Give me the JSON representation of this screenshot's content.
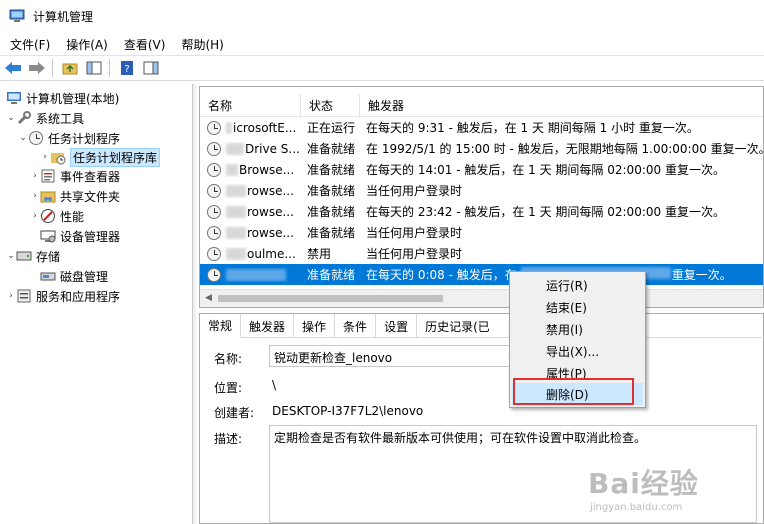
{
  "window": {
    "title": "计算机管理"
  },
  "menu": [
    "文件(F)",
    "操作(A)",
    "查看(V)",
    "帮助(H)"
  ],
  "toolbar": {
    "icons": [
      "back-icon",
      "forward-icon",
      "up-folder-icon",
      "show-tree-icon",
      "help-icon",
      "action-pane-icon"
    ]
  },
  "tree": {
    "root": "计算机管理(本地)",
    "system_tools": "系统工具",
    "task_scheduler": "任务计划程序",
    "task_library": "任务计划程序库",
    "event_viewer": "事件查看器",
    "shared_folders": "共享文件夹",
    "performance": "性能",
    "device_manager": "设备管理器",
    "storage": "存储",
    "disk_management": "磁盘管理",
    "services": "服务和应用程序"
  },
  "tasklist": {
    "headers": {
      "name": "名称",
      "status": "状态",
      "trigger": "触发器"
    },
    "rows": [
      {
        "name": "icrosoftE...",
        "status": "正在运行",
        "trigger": "在每天的 9:31 - 触发后，在 1 天 期间每隔 1 小时 重复一次。"
      },
      {
        "name": "Drive S...",
        "status": "准备就绪",
        "trigger": "在 1992/5/1 的 15:00 时 - 触发后，无限期地每隔 1.00:00:00 重复一次。"
      },
      {
        "name": "Browse...",
        "status": "准备就绪",
        "trigger": "在每天的 14:01 - 触发后，在 1 天 期间每隔 02:00:00 重复一次。"
      },
      {
        "name": "rowse...",
        "status": "准备就绪",
        "trigger": "当任何用户登录时"
      },
      {
        "name": "rowse...",
        "status": "准备就绪",
        "trigger": "在每天的 23:42 - 触发后，在 1 天 期间每隔 02:00:00 重复一次。"
      },
      {
        "name": "rowse...",
        "status": "准备就绪",
        "trigger": "当任何用户登录时"
      },
      {
        "name": "oulme...",
        "status": "禁用",
        "trigger": "当任何用户登录时"
      },
      {
        "name": "",
        "status": "准备就绪",
        "trigger": "在每天的 0:08 - 触发后，在"
      }
    ],
    "selected_row_tail": "重复一次。"
  },
  "tabs": [
    "常规",
    "触发器",
    "操作",
    "条件",
    "设置",
    "历史记录(已"
  ],
  "props": {
    "name_label": "名称:",
    "name_value": "锐动更新检查_lenovo",
    "location_label": "位置:",
    "location_value": "\\",
    "author_label": "创建者:",
    "author_value": "DESKTOP-I37F7L2\\lenovo",
    "desc_label": "描述:",
    "desc_value": "定期检查是否有软件最新版本可供使用；可在软件设置中取消此检查。"
  },
  "context_menu": {
    "run": "运行(R)",
    "end": "结束(E)",
    "disable": "禁用(I)",
    "export": "导出(X)...",
    "properties": "属性(P)",
    "delete": "删除(D)"
  },
  "watermark": {
    "logo": "Bai经验",
    "url": "jingyan.baidu.com"
  },
  "colors": {
    "selection": "#0078d7",
    "highlight": "#cce8ff",
    "annotation": "#e03030"
  }
}
